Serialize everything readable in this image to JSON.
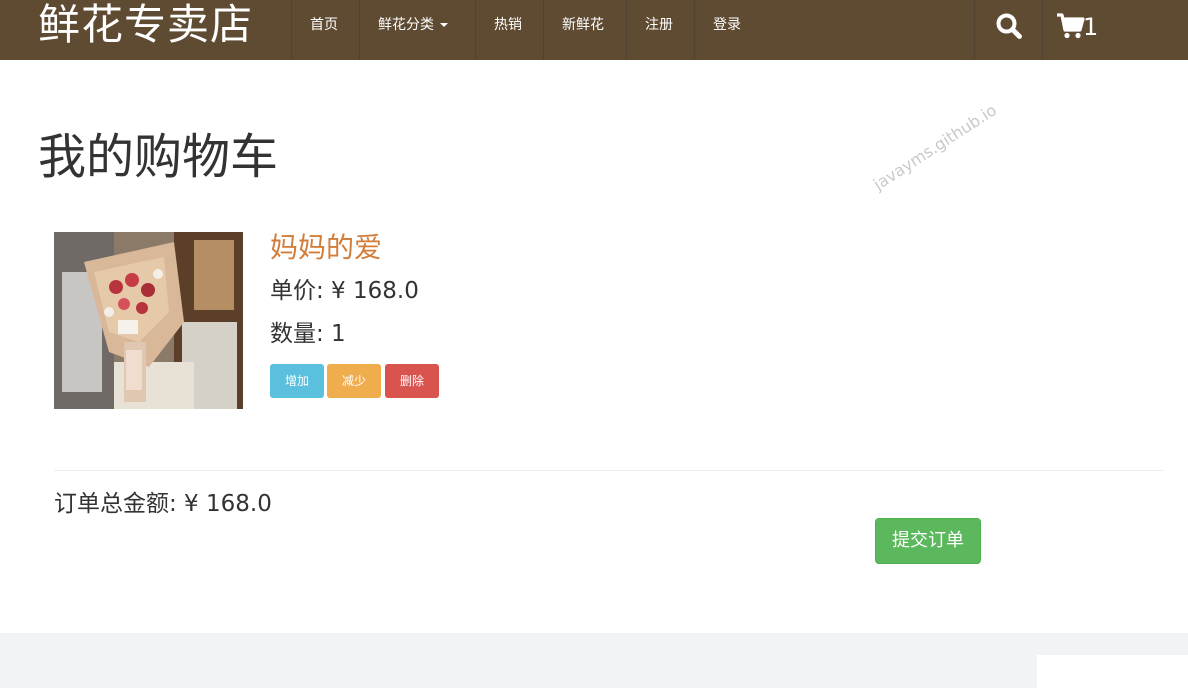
{
  "colors": {
    "navbar_bg": "#5f4a32",
    "product_name": "#d27d3a",
    "btn_add": "#5bc0de",
    "btn_decrease": "#f0ad4e",
    "btn_delete": "#d9534f",
    "btn_submit": "#5cb85c"
  },
  "navbar": {
    "brand": "鲜花专卖店",
    "items": [
      {
        "label": "首页"
      },
      {
        "label": "鲜花分类"
      },
      {
        "label": "热销"
      },
      {
        "label": "新鲜花"
      },
      {
        "label": "注册"
      },
      {
        "label": "登录"
      }
    ],
    "search_icon": "search-icon",
    "cart_icon": "cart-icon",
    "cart_count": "1"
  },
  "page": {
    "title": "我的购物车",
    "watermark": "javayms.github.io"
  },
  "cart": {
    "items": [
      {
        "name": "妈妈的爱",
        "price_text": "单价: ¥ 168.0",
        "quantity_text": "数量: 1",
        "add_label": "增加",
        "decrease_label": "减少",
        "delete_label": "删除"
      }
    ],
    "total_text": "订单总金额: ¥ 168.0",
    "submit_label": "提交订单"
  }
}
